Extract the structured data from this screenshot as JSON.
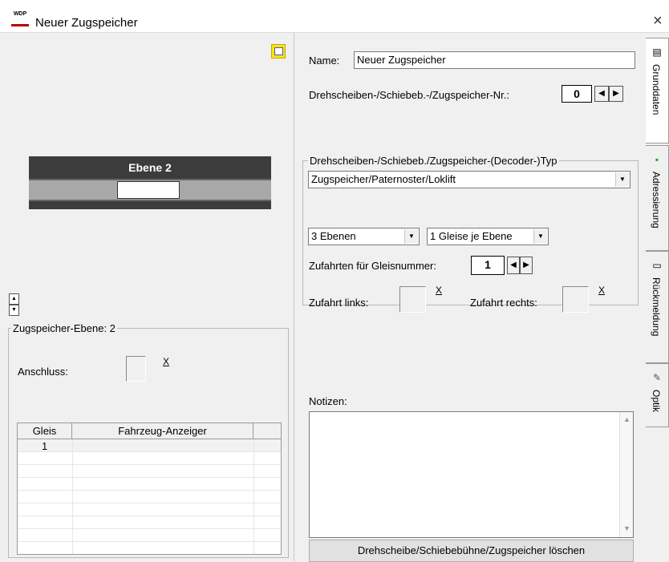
{
  "window": {
    "title": "Neuer Zugspeicher",
    "app_icon_text": "WDP",
    "close_label": "×"
  },
  "left": {
    "ebene_label": "Ebene 2",
    "spin_up": "▲",
    "spin_down": "▼",
    "group_title": "Zugspeicher-Ebene: 2",
    "anschluss_label": "Anschluss:",
    "x_label": "X",
    "table": {
      "columns": [
        "Gleis",
        "Fahrzeug-Anzeiger"
      ],
      "rows": [
        {
          "gleis": "1",
          "anzeiger": ""
        }
      ]
    }
  },
  "right": {
    "name_label": "Name:",
    "name_value": "Neuer Zugspeicher",
    "nr_label": "Drehscheiben-/Schiebeb.-/Zugspeicher-Nr.:",
    "nr_value": "0",
    "type_group_title": "Drehscheiben-/Schiebeb./Zugspeicher-(Decoder-)Typ",
    "type_value": "Zugspeicher/Paternoster/Loklift",
    "ebenen_value": "3 Ebenen",
    "gleise_value": "1 Gleise je Ebene",
    "zufahrten_label": "Zufahrten für Gleisnummer:",
    "zufahrten_value": "1",
    "zufahrt_links_label": "Zufahrt links:",
    "zufahrt_rechts_label": "Zufahrt rechts:",
    "x_label": "X",
    "notizen_label": "Notizen:",
    "notizen_value": "",
    "delete_button": "Drehscheibe/Schiebebühne/Zugspeicher löschen"
  },
  "tabs": [
    {
      "label": "Grunddaten",
      "icon": "document-icon",
      "glyph": "▤",
      "active": true
    },
    {
      "label": "Adressierung",
      "icon": "decoder-icon",
      "glyph": "▪",
      "active": false
    },
    {
      "label": "Rückmeldung",
      "icon": "feedback-icon",
      "glyph": "▭",
      "active": false
    },
    {
      "label": "Optik",
      "icon": "brush-icon",
      "glyph": "✎",
      "active": false
    }
  ],
  "colors": {
    "ebene_dark": "#3c3c3c",
    "ebene_track": "#a8a8a8",
    "edit_icon_yellow": "#ffe600",
    "decoder_icon_green": "#1aa81a"
  }
}
